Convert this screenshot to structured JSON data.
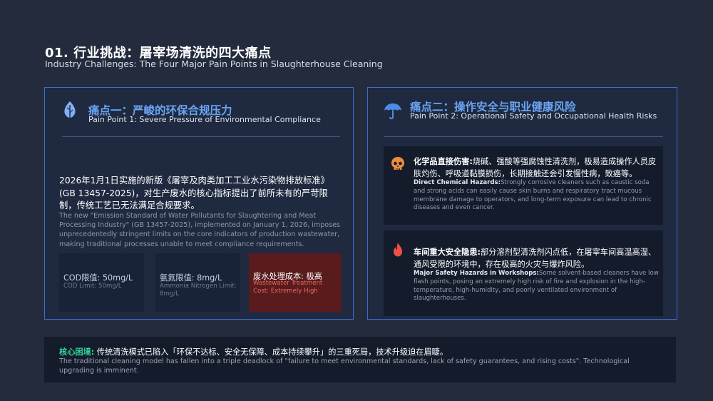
{
  "header": {
    "title_zh": "01. 行业挑战：屠宰场清洗的四大痛点",
    "title_en": "Industry Challenges: The Four Major Pain Points in Slaughterhouse Cleaning"
  },
  "left_panel": {
    "icon": "leaf-icon",
    "heading_zh": "痛点一：严峻的环保合规压力",
    "heading_en": "Pain Point 1: Severe Pressure of Environmental Compliance",
    "body_zh": "2026年1月1日实施的新版《屠宰及肉类加工工业水污染物排放标准》(GB 13457-2025)，对生产废水的核心指标提出了前所未有的严苛限制，传统工艺已无法满足合规要求。",
    "body_en": "The new \"Emission Standard of Water Pollutants for Slaughtering and Meat Processing Industry\" (GB 13457-2025), implemented on January 1, 2026, imposes unprecedentedly stringent limits on the core indicators of production wastewater, making traditional processes unable to meet compliance requirements.",
    "metrics": [
      {
        "zh": "COD限值: 50mg/L",
        "en": "COD Limit: 50mg/L"
      },
      {
        "zh": "氨氮限值: 8mg/L",
        "en": "Ammonia Nitrogen Limit: 8mg/L"
      },
      {
        "zh": "废水处理成本: 极高",
        "en": "Wastewater Treatment Cost: Extremely High"
      }
    ]
  },
  "right_panel": {
    "icon": "umbrella-icon",
    "heading_zh": "痛点二：操作安全与职业健康风险",
    "heading_en": "Pain Point 2: Operational Safety and Occupational Health Risks",
    "cards": [
      {
        "icon": "skull-icon",
        "label_zh": "化学品直接伤害:",
        "text_zh": "烧碱、强酸等强腐蚀性清洗剂，极易造成操作人员皮肤灼伤、呼吸道黏膜损伤，长期接触还会引发慢性病，致癌等。",
        "label_en": "Direct Chemical Hazards:",
        "text_en": "Strongly corrosive cleaners such as caustic soda and strong acids can easily cause skin burns and respiratory tract mucous membrane damage to operators, and long-term exposure can lead to chronic diseases and even cancer."
      },
      {
        "icon": "fire-icon",
        "label_zh": "车间重大安全隐患:",
        "text_zh": "部分溶剂型清洗剂闪点低，在屠宰车间高温高湿、通风受限的环境中，存在极高的火灾与爆炸风险。",
        "label_en": "Major Safety Hazards in Workshops:",
        "text_en": "Some solvent-based cleaners have low flash points, posing an extremely high risk of fire and explosion in the high-temperature, high-humidity, and poorly ventilated environment of slaughterhouses."
      }
    ]
  },
  "bottom": {
    "label_zh": "核心困境:",
    "text_zh": "传统清洗模式已陷入「环保不达标、安全无保障、成本持续攀升」的三重死局，技术升级迫在眉睫。",
    "text_en": "The traditional cleaning model has fallen into a triple deadlock of \"failure to meet environmental standards, lack of safety guarantees, and rising costs\". Technological upgrading is imminent."
  },
  "colors": {
    "background": "#232b3c",
    "panel_border": "#3a6fd0",
    "heading_blue": "#6aa4f2",
    "accent_orange": "#f08a3c",
    "accent_red": "#f0504a",
    "accent_green": "#34d399",
    "cost_box": "#591b1e"
  }
}
